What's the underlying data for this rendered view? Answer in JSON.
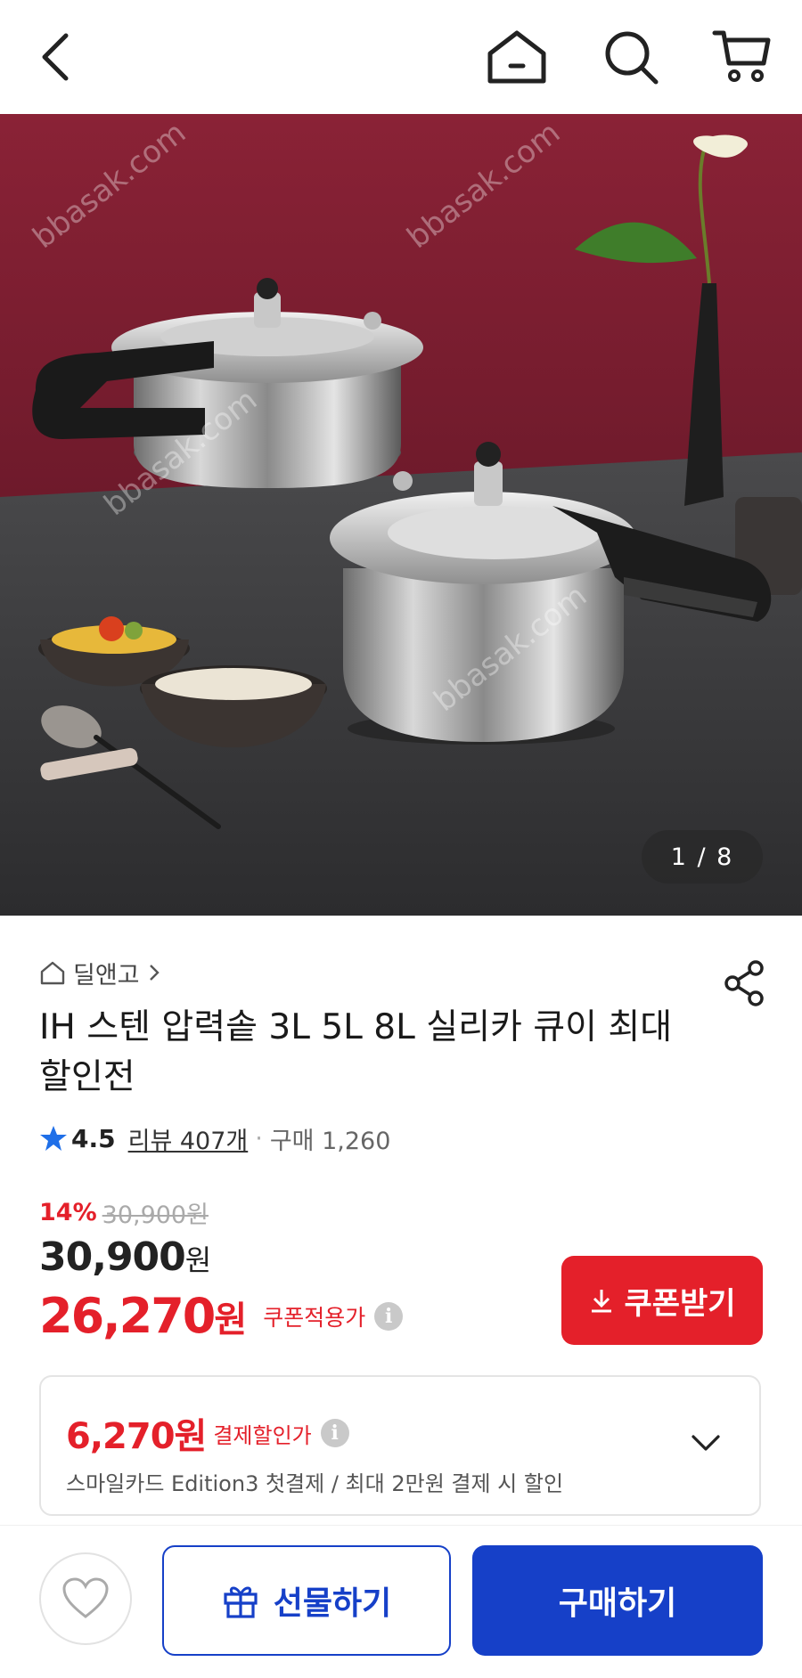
{
  "header": {
    "icons": [
      "chevron-left-icon",
      "home-icon",
      "search-icon",
      "cart-icon"
    ]
  },
  "gallery": {
    "counter": "1 / 8",
    "watermark": "bbasak.com"
  },
  "product": {
    "store": "딜앤고",
    "title": "IH 스텐 압력솥 3L 5L 8L 실리카 큐이 최대 할인전",
    "rating": "4.5",
    "review_label": "리뷰 407개",
    "separator": "·",
    "purchase_count": "구매 1,260",
    "discount_rate": "14%",
    "original_price": "30,900원",
    "price_value": "30,900",
    "price_unit": "원",
    "coupon_price_value": "26,270",
    "coupon_price_unit": "원",
    "coupon_price_label": "쿠폰적용가",
    "coupon_button": "쿠폰받기"
  },
  "payment_card": {
    "amount_value": "6,270원",
    "amount_label": "결제할인가",
    "description": "스마일카드 Edition3 첫결제 / 최대 2만원 결제 시 할인"
  },
  "bottom": {
    "gift_button": "선물하기",
    "buy_button": "구매하기"
  },
  "colors": {
    "accent_red": "#e4202a",
    "accent_blue": "#1640c8",
    "star": "#1f6fe8"
  }
}
